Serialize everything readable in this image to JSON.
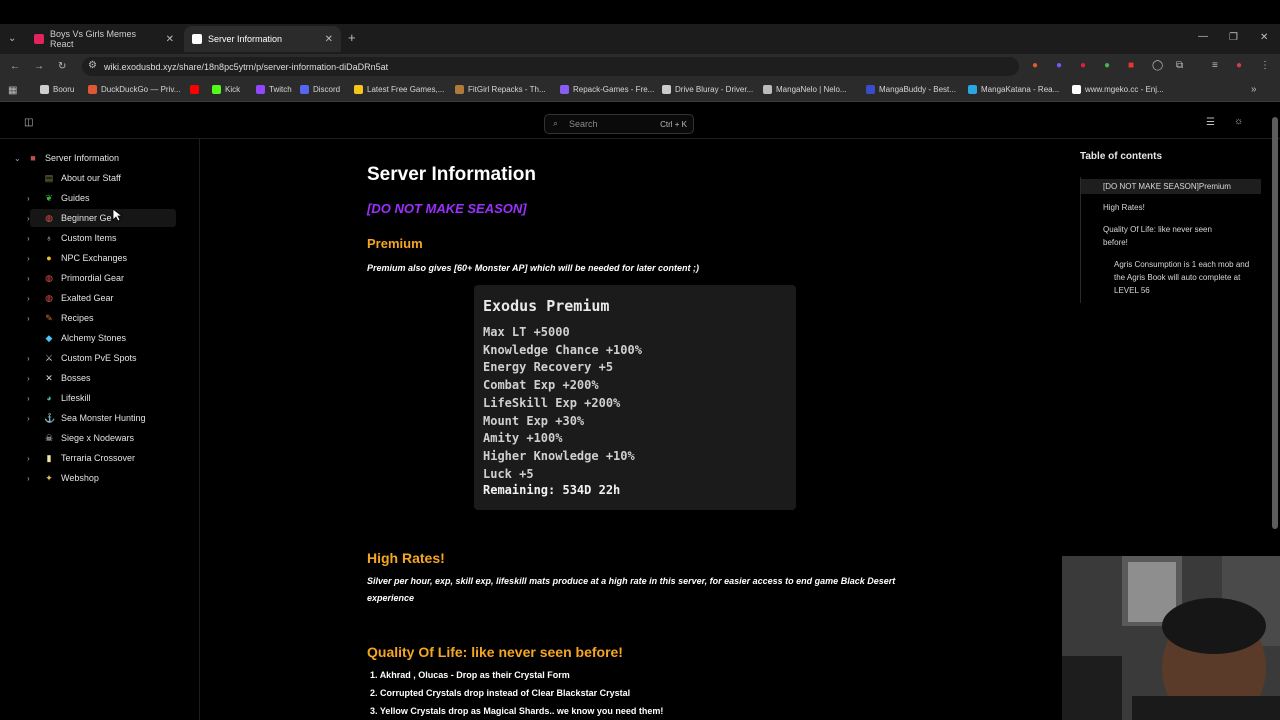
{
  "browser": {
    "tabs": [
      {
        "label": "Boys Vs Girls Memes React",
        "active": false,
        "favicon_color": "#e0245e"
      },
      {
        "label": "Server Information",
        "active": true,
        "favicon_color": "#ffffff"
      }
    ],
    "new_tab_label": "+",
    "url": "wiki.exodusbd.xyz/share/18n8pc5ytrn/p/server-information-diDaDRn5at",
    "bookmarks": [
      {
        "label": "Booru",
        "color": "#cfcfcf"
      },
      {
        "label": "DuckDuckGo — Priv...",
        "color": "#de5833"
      },
      {
        "label": "",
        "color": "#ff0000"
      },
      {
        "label": "Kick",
        "color": "#53fc18"
      },
      {
        "label": "Twitch",
        "color": "#9146ff"
      },
      {
        "label": "Discord",
        "color": "#5865f2"
      },
      {
        "label": "Latest Free Games,...",
        "color": "#f5c518"
      },
      {
        "label": "FitGirl Repacks - Th...",
        "color": "#b07a3a"
      },
      {
        "label": "Repack-Games - Fre...",
        "color": "#8a5cf6"
      },
      {
        "label": "Drive Bluray - Driver...",
        "color": "#cccccc"
      },
      {
        "label": "MangaNelo | Nelo...",
        "color": "#bbbbbb"
      },
      {
        "label": "MangaBuddy - Best...",
        "color": "#3b4cca"
      },
      {
        "label": "MangaKatana - Rea...",
        "color": "#2aa7e0"
      },
      {
        "label": "www.mgeko.cc - Enj...",
        "color": "#ffffff"
      }
    ]
  },
  "header": {
    "search_placeholder": "Search",
    "search_shortcut": "Ctrl + K"
  },
  "sidebar": {
    "root": {
      "label": "Server Information",
      "icon": "book-icon"
    },
    "items": [
      {
        "label": "About our Staff",
        "icon": "book-icon",
        "color": "#7a8a4a",
        "expandable": false
      },
      {
        "label": "Guides",
        "icon": "leaf-icon",
        "color": "#3db03d",
        "expandable": true
      },
      {
        "label": "Beginner Ge",
        "icon": "shield-icon",
        "color": "#d9534f",
        "expandable": true
      },
      {
        "label": "Custom Items",
        "icon": "potion-icon",
        "color": "#dddddd",
        "expandable": true
      },
      {
        "label": "NPC Exchanges",
        "icon": "coin-icon",
        "color": "#f0c419",
        "expandable": true
      },
      {
        "label": "Primordial Gear",
        "icon": "shield-icon",
        "color": "#d9534f",
        "expandable": true
      },
      {
        "label": "Exalted Gear",
        "icon": "shield-icon",
        "color": "#d9534f",
        "expandable": true
      },
      {
        "label": "Recipes",
        "icon": "scroll-icon",
        "color": "#cc7733",
        "expandable": true
      },
      {
        "label": "Alchemy Stones",
        "icon": "gem-icon",
        "color": "#4fc3f7",
        "expandable": false
      },
      {
        "label": "Custom PvE Spots",
        "icon": "swords-icon",
        "color": "#cccccc",
        "expandable": true
      },
      {
        "label": "Bosses",
        "icon": "crossed-swords-icon",
        "color": "#dddddd",
        "expandable": true
      },
      {
        "label": "Lifeskill",
        "icon": "globe-icon",
        "color": "#4db6ac",
        "expandable": true
      },
      {
        "label": "Sea Monster Hunting",
        "icon": "anchor-icon",
        "color": "#cccccc",
        "expandable": true
      },
      {
        "label": "Siege x Nodewars",
        "icon": "skull-icon",
        "color": "#eeeeee",
        "expandable": false
      },
      {
        "label": "Terraria Crossover",
        "icon": "bar-icon",
        "color": "#f5e6a8",
        "expandable": true
      },
      {
        "label": "Webshop",
        "icon": "diamond-icon",
        "color": "#e0c060",
        "expandable": true
      }
    ]
  },
  "main": {
    "title": "Server Information",
    "season_note": "[DO NOT MAKE SEASON]",
    "premium_heading": "Premium",
    "premium_text": "Premium also gives [60+ Monster AP] which will be needed for later content ;)",
    "card": {
      "title": "Exodus Premium",
      "lines": [
        "Max LT +5000",
        "Knowledge Chance +100%",
        "Energy Recovery +5",
        "Combat Exp +200%",
        "LifeSkill Exp +200%",
        "Mount Exp +30%",
        "Amity +100%",
        "Higher Knowledge +10%",
        "Luck +5"
      ],
      "remaining": "Remaining: 534D 22h"
    },
    "rates_heading": "High Rates!",
    "rates_text": "Silver per hour, exp, skill exp, lifeskill mats produce at a high rate in this server, for easier access to end game Black Desert experience",
    "qol_heading": "Quality Of Life: like never seen before!",
    "qol_items": [
      "Akhrad , Olucas - Drop as their Crystal Form",
      "Corrupted Crystals drop instead of Clear Blackstar Crystal",
      "Yellow Crystals drop as Magical Shards.. we know you need them!"
    ]
  },
  "toc": {
    "heading": "Table of contents",
    "items": [
      {
        "label": "[DO NOT MAKE SEASON]Premium",
        "active": true
      },
      {
        "label": "High Rates!",
        "active": false
      },
      {
        "label": "Quality Of Life: like never seen before!",
        "active": false
      },
      {
        "label": "Agris Consumption is 1 each mob and the Agris Book will auto complete at LEVEL 56",
        "active": false
      }
    ]
  }
}
